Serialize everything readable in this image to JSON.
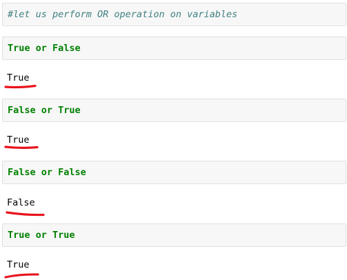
{
  "comment_cell": {
    "text": "#let us perform OR operation on variables"
  },
  "cells": [
    {
      "input": "True or False",
      "output": "True"
    },
    {
      "input": "False or True",
      "output": "True"
    },
    {
      "input": "False or False",
      "output": "False"
    },
    {
      "input": "True or True",
      "output": "True"
    }
  ],
  "colors": {
    "comment": "#408080",
    "keyword": "#008000",
    "cell_background": "#f7f7f7",
    "cell_border": "#e0e0e0",
    "annotation_underline": "#e8141e"
  }
}
